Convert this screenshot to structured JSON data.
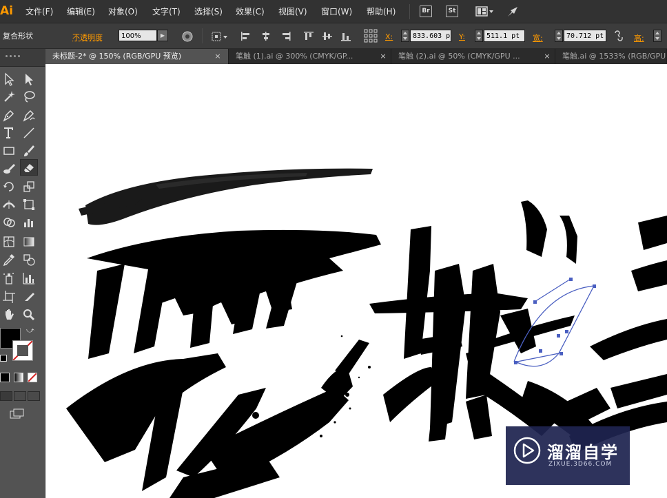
{
  "app": {
    "logo": "Ai",
    "accent_color": "#ff9a00"
  },
  "menu": {
    "items": [
      "文件(F)",
      "编辑(E)",
      "对象(O)",
      "文字(T)",
      "选择(S)",
      "效果(C)",
      "视图(V)",
      "窗口(W)",
      "帮助(H)"
    ],
    "bridge_label": "Br",
    "stock_label": "St"
  },
  "control": {
    "selection_type": "复合形状",
    "opacity_label": "不透明度",
    "opacity_value": "100%",
    "x_label": "X:",
    "x_value": "833.603 p",
    "y_label": "Y:",
    "y_value": "511.1 pt",
    "w_label": "宽:",
    "w_value": "70.712 pt",
    "h_label": "高:"
  },
  "tabs": [
    {
      "label": "未标题-2* @ 150% (RGB/GPU 预览)",
      "active": true
    },
    {
      "label": "笔触 (1).ai @ 300% (CMYK/GP...",
      "active": false
    },
    {
      "label": "笔触 (2).ai @ 50% (CMYK/GPU ...",
      "active": false
    },
    {
      "label": "笔触.ai @ 1533% (RGB/GPU",
      "active": false
    }
  ],
  "tab_close_glyph": "×",
  "tools": [
    "selection-arrow-icon",
    "direct-selection-icon",
    "magic-wand-icon",
    "lasso-icon",
    "pen-icon",
    "curvature-pen-icon",
    "type-icon",
    "line-icon",
    "rectangle-icon",
    "paintbrush-icon",
    "blob-brush-icon",
    "eraser-icon",
    "rotate-icon",
    "scale-icon",
    "width-icon",
    "free-transform-icon",
    "shape-builder-icon",
    "chart-icon",
    "mesh-icon",
    "gradient-icon",
    "eyedropper-icon",
    "blend-icon",
    "symbol-sprayer-icon",
    "column-graph-icon",
    "artboard-icon",
    "slice-icon",
    "hand-icon",
    "zoom-icon"
  ],
  "colors": {
    "fill": "#000000",
    "stroke": "#ffffff",
    "path_selection": "#4a5fc1"
  },
  "watermark": {
    "title": "溜溜自学",
    "subtitle": "ZIXUE.3D66.COM"
  }
}
